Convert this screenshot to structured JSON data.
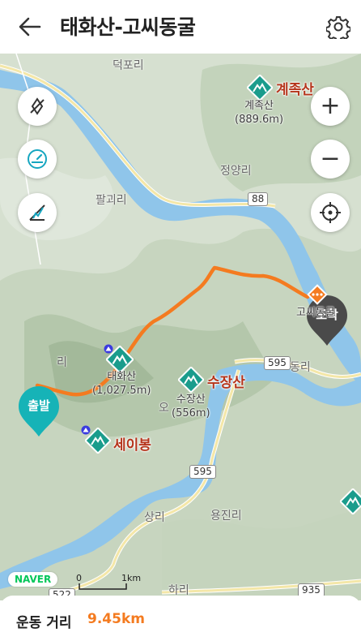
{
  "header": {
    "title": "태화산-고씨동굴",
    "back_icon": "arrow-left-icon",
    "settings_icon": "gear-icon"
  },
  "map": {
    "controls_left": [
      {
        "name": "compass-off-icon"
      },
      {
        "name": "speedometer-icon"
      },
      {
        "name": "elevation-chart-icon"
      }
    ],
    "controls_right": [
      {
        "name": "zoom-in-icon",
        "symbol": "+"
      },
      {
        "name": "zoom-out-icon",
        "symbol": "−"
      },
      {
        "name": "locate-me-icon"
      }
    ],
    "places": [
      "덕포리",
      "정양리",
      "팔괴리",
      "동리",
      "리",
      "오",
      "상리",
      "용진리",
      "하리"
    ],
    "mountains": {
      "gyejoksan": {
        "label": "계족산",
        "name": "계족산",
        "height": "(889.6m)"
      },
      "taehwasan": {
        "name": "태화산",
        "height": "(1,027.5m)"
      },
      "sujangsan": {
        "label": "수장산",
        "name": "수장산",
        "height": "(556m)"
      },
      "seibong": {
        "label": "세이봉"
      }
    },
    "start_label": "출발",
    "end_label": "도착",
    "end_place": "고씨동굴",
    "roads": [
      "88",
      "595",
      "595",
      "522",
      "935"
    ],
    "brand": "NAVER",
    "scale_zero": "0",
    "scale_unit": "1km",
    "route_color": "#f47b20"
  },
  "footer": {
    "label": "운동 거리",
    "value": "9.45km"
  }
}
